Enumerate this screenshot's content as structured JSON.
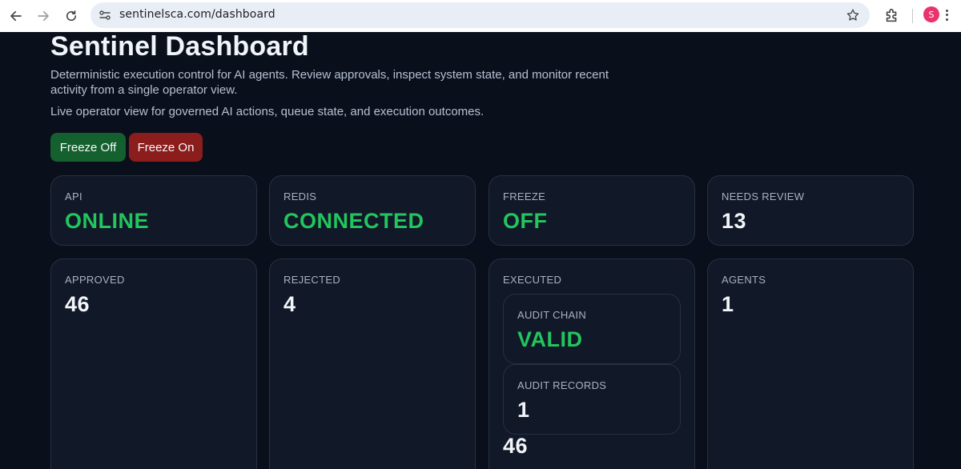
{
  "browser": {
    "url": "sentinelsca.com/dashboard",
    "profile_initial": "S"
  },
  "header": {
    "title": "Sentinel Dashboard",
    "description": "Deterministic execution control for AI agents. Review approvals, inspect system state, and monitor recent activity from a single operator view.",
    "subtitle": "Live operator view for governed AI actions, queue state, and execution outcomes."
  },
  "controls": {
    "freeze_off_label": "Freeze Off",
    "freeze_on_label": "Freeze On"
  },
  "status_cards": {
    "api": {
      "label": "API",
      "value": "ONLINE"
    },
    "redis": {
      "label": "REDIS",
      "value": "CONNECTED"
    },
    "freeze": {
      "label": "FREEZE",
      "value": "OFF"
    },
    "needs_review": {
      "label": "NEEDS REVIEW",
      "value": "13"
    }
  },
  "metric_cards": {
    "approved": {
      "label": "APPROVED",
      "value": "46"
    },
    "rejected": {
      "label": "REJECTED",
      "value": "4"
    },
    "executed": {
      "label": "EXECUTED",
      "value": "46",
      "audit_chain": {
        "label": "AUDIT CHAIN",
        "value": "VALID"
      },
      "audit_records": {
        "label": "AUDIT RECORDS",
        "value": "1"
      }
    },
    "agents": {
      "label": "AGENTS",
      "value": "1"
    }
  },
  "colors": {
    "status_ok": "#22c55e",
    "freeze_off_button": "#15602f",
    "freeze_on_button": "#8b1d1d",
    "background": "#0a0f1c",
    "card": "#111827"
  }
}
